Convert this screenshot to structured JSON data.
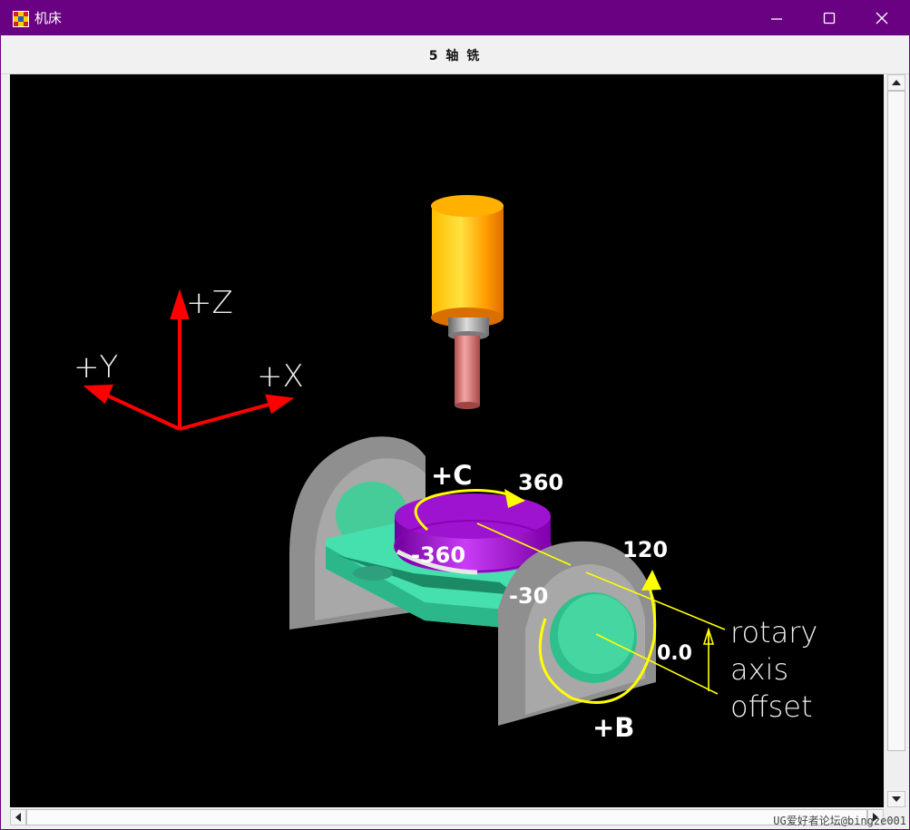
{
  "window": {
    "title": "机床"
  },
  "toolbar": {
    "label": "5 轴 铣"
  },
  "scene": {
    "axis_labels": {
      "z": "+Z",
      "y": "+Y",
      "x": "+X"
    },
    "rotation_labels": {
      "c_axis": "+C",
      "b_axis": "+B"
    },
    "values": {
      "c_max": "360",
      "c_min": "-360",
      "b_max": "120",
      "b_min": "-30",
      "offset_value": "0.0"
    },
    "annotation": {
      "line1": "rotary",
      "line2": "axis",
      "line3": "offset"
    },
    "colors": {
      "background": "#000000",
      "axis_arrows": "#ff0000",
      "spindle_body": "#ffb000",
      "tool_shank": "#a9a9a9",
      "tool": "#e07c7c",
      "rotary_table": "#a000d0",
      "trunnion": "#999999",
      "cradle": "#4ee4b0",
      "annotation_lines": "#ffff00"
    }
  },
  "watermark": "UG爱好者论坛@bingze001"
}
